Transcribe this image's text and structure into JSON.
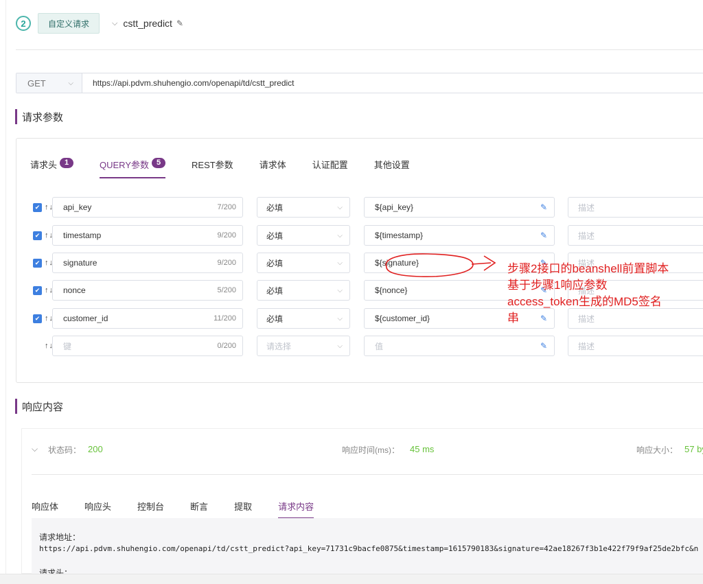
{
  "step": {
    "number": "2",
    "type_button": "自定义请求",
    "name": "cstt_predict"
  },
  "request": {
    "method": "GET",
    "url": "https://api.pdvm.shuhengio.com/openapi/td/cstt_predict"
  },
  "sections": {
    "params_title": "请求参数",
    "response_title": "响应内容"
  },
  "param_tabs": [
    {
      "label": "请求头",
      "badge": "1"
    },
    {
      "label": "QUERY参数",
      "badge": "5"
    },
    {
      "label": "REST参数",
      "badge": ""
    },
    {
      "label": "请求体",
      "badge": ""
    },
    {
      "label": "认证配置",
      "badge": ""
    },
    {
      "label": "其他设置",
      "badge": ""
    }
  ],
  "rows": [
    {
      "key": "api_key",
      "count": "7/200",
      "required": "必填",
      "value": "${api_key}",
      "desc": "描述"
    },
    {
      "key": "timestamp",
      "count": "9/200",
      "required": "必填",
      "value": "${timestamp}",
      "desc": "描述"
    },
    {
      "key": "signature",
      "count": "9/200",
      "required": "必填",
      "value": "${signature}",
      "desc": "描述"
    },
    {
      "key": "nonce",
      "count": "5/200",
      "required": "必填",
      "value": "${nonce}",
      "desc": "描述"
    },
    {
      "key": "customer_id",
      "count": "11/200",
      "required": "必填",
      "value": "${customer_id}",
      "desc": "描述"
    },
    {
      "key": "键",
      "count": "0/200",
      "required": "请选择",
      "value": "值",
      "desc": "描述"
    }
  ],
  "annotation": {
    "line1": "步骤2接口的beanshell前置脚本",
    "line2": "基于步骤1响应参数",
    "line3": "access_token生成的MD5签名",
    "line4": "串",
    "color": "#e02020"
  },
  "response": {
    "status_label": "状态码：",
    "status_value": "200",
    "time_label": "响应时间(ms)：",
    "time_value": "45 ms",
    "size_label": "响应大小：",
    "size_value": "57 byt",
    "tabs": [
      "响应体",
      "响应头",
      "控制台",
      "断言",
      "提取",
      "请求内容"
    ],
    "url_label": "请求地址：",
    "full_url": "https://api.pdvm.shuhengio.com/openapi/td/cstt_predict?api_key=71731c9bacfe0875&timestamp=1615790183&signature=42ae18267f3b1e422f79f9af25de2bfc&n",
    "headers_label": "请求头："
  },
  "colors": {
    "accent": "#783887",
    "step_circle": "#26a69a",
    "checkbox": "#3d7fe0",
    "success": "#67c23a"
  }
}
